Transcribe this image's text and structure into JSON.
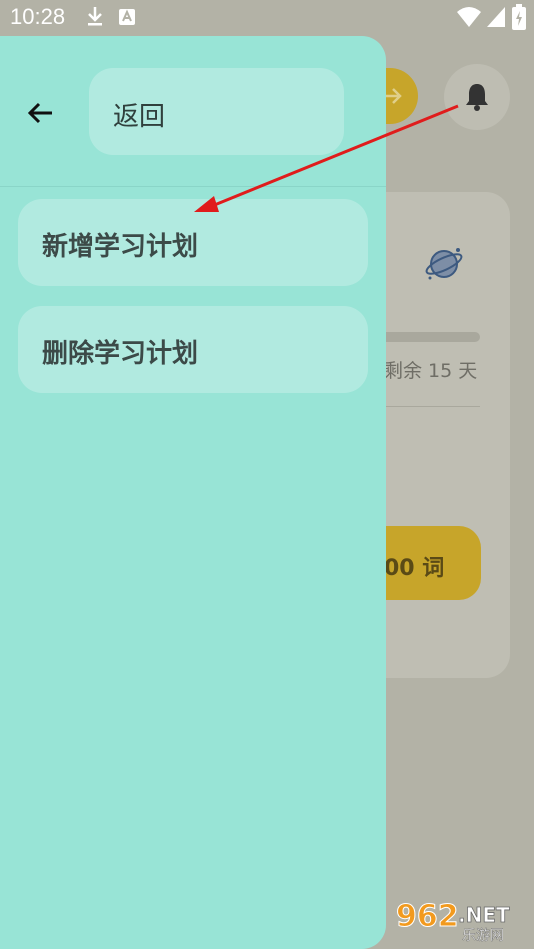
{
  "status_bar": {
    "time": "10:28",
    "icons": [
      "download-icon",
      "app-notification-icon",
      "wifi-icon",
      "signal-icon",
      "battery-charging-icon"
    ]
  },
  "background_page": {
    "remaining_text": "剩余 15 天",
    "word_button_text": "00 词",
    "icons": [
      "arrow-right-icon",
      "bell-icon",
      "planet-icon"
    ]
  },
  "drawer": {
    "back_label": "返回",
    "menu_items": [
      {
        "label": "新增学习计划"
      },
      {
        "label": "删除学习计划"
      }
    ]
  },
  "watermark": {
    "brand": "962",
    "suffix": ".NET",
    "subtitle": "乐游网"
  },
  "colors": {
    "drawer_bg": "#98e4d6",
    "pill_bg": "#b1eae0",
    "accent_yellow": "#c7a52a",
    "annotation_red": "#e01c1c"
  }
}
